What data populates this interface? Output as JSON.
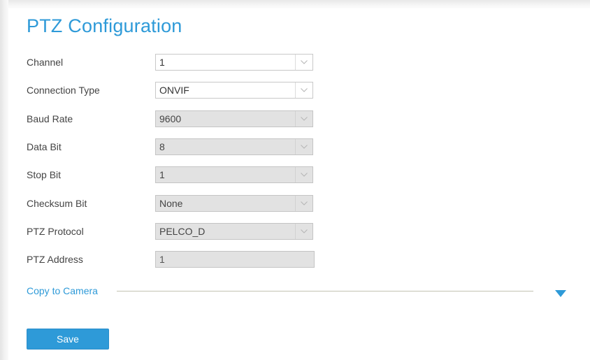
{
  "page": {
    "title": "PTZ Configuration"
  },
  "fields": [
    {
      "label": "Channel",
      "value": "1",
      "type": "select",
      "disabled": false
    },
    {
      "label": "Connection Type",
      "value": "ONVIF",
      "type": "select",
      "disabled": false
    },
    {
      "label": "Baud Rate",
      "value": "9600",
      "type": "select",
      "disabled": true
    },
    {
      "label": "Data Bit",
      "value": "8",
      "type": "select",
      "disabled": true
    },
    {
      "label": "Stop Bit",
      "value": "1",
      "type": "select",
      "disabled": true
    },
    {
      "label": "Checksum Bit",
      "value": "None",
      "type": "select",
      "disabled": true
    },
    {
      "label": "PTZ Protocol",
      "value": "PELCO_D",
      "type": "select",
      "disabled": true
    },
    {
      "label": "PTZ Address",
      "value": "1",
      "type": "text",
      "disabled": true
    }
  ],
  "copy": {
    "label": "Copy to Camera",
    "expand_icon": "triangle-down-icon"
  },
  "actions": {
    "save_label": "Save"
  },
  "colors": {
    "accent": "#2e9ad8",
    "label_text": "#444444",
    "disabled_field": "#e2e2e2",
    "divider_line": "#c2c2b2"
  }
}
